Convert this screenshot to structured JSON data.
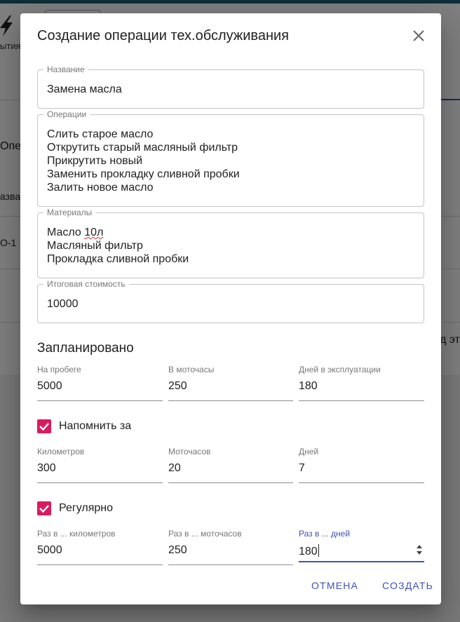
{
  "background": {
    "logo_text": "ытия",
    "row_texts": [
      "Опер",
      "азван",
      "О-1"
    ],
    "right_text": "д эт"
  },
  "dialog": {
    "title": "Создание операции тех.обслуживания",
    "fields": {
      "name": {
        "label": "Название",
        "value": "Замена масла"
      },
      "operations": {
        "label": "Операции",
        "value": "Слить старое масло\nОткрутить старый масляный фильтр\nПрикрутить новый\nЗаменить прокладку сливной пробки\nЗалить новое масло"
      },
      "materials": {
        "label": "Материалы",
        "value_first": "Масло ",
        "value_misspelled": "10л",
        "value_rest": "Масляный фильтр\nПрокладка сливной пробки"
      },
      "total_cost": {
        "label": "Итоговая стоимость",
        "value": "10000"
      }
    },
    "planned": {
      "title": "Запланировано",
      "mileage": {
        "label": "На пробеге",
        "value": "5000"
      },
      "moto_hours": {
        "label": "В моточасы",
        "value": "250"
      },
      "days": {
        "label": "Дней в эксплуатации",
        "value": "180"
      }
    },
    "remind": {
      "checkbox_label": "Напомнить за",
      "checked": true,
      "km": {
        "label": "Километров",
        "value": "300"
      },
      "moto_hours": {
        "label": "Моточасов",
        "value": "20"
      },
      "days": {
        "label": "Дней",
        "value": "7"
      }
    },
    "regular": {
      "checkbox_label": "Регулярно",
      "checked": true,
      "km": {
        "label": "Раз в ... километров",
        "value": "5000"
      },
      "moto_hours": {
        "label": "Раз в ... моточасов",
        "value": "250"
      },
      "days": {
        "label": "Раз в ... дней",
        "value": "180"
      }
    },
    "actions": {
      "cancel": "Отмена",
      "create": "Создать"
    }
  },
  "colors": {
    "primary": "#3f51b5",
    "checkbox": "#d81b60",
    "topbar": "#1a5f73"
  },
  "icons": [
    "close-icon",
    "check-icon",
    "spinner-arrows-icon",
    "lightning-logo-icon"
  ]
}
